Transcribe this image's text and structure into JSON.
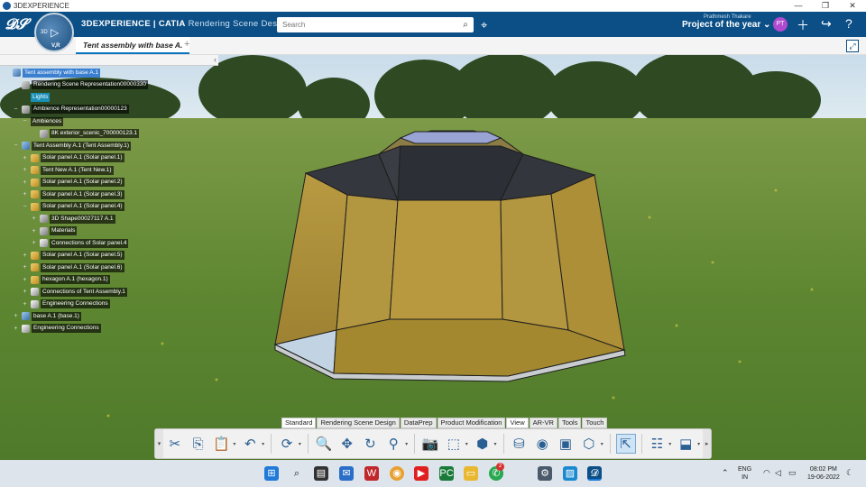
{
  "window": {
    "title": "3DEXPERIENCE",
    "controls": [
      "—",
      "❐",
      "✕"
    ]
  },
  "header": {
    "brand_main": "3DEXPERIENCE | CATIA",
    "brand_sub": "Rendering Scene Design",
    "search_placeholder": "Search",
    "user_name": "Prathmesh Thakare",
    "project": "Project of the year",
    "avatar": "PT"
  },
  "compass": {
    "label_3d": "3D",
    "label_v": "V,R"
  },
  "tabs": {
    "active": "Tent assembly with base A.",
    "add": "+"
  },
  "tree": [
    {
      "label": "Tent assembly with base A.1",
      "icon": "prod",
      "pm": "−",
      "level": 0,
      "style": "sel"
    },
    {
      "label": "Rendering Scene Representation00000330",
      "icon": "rep",
      "pm": "+",
      "level": 1,
      "style": ""
    },
    {
      "label": "Lights",
      "icon": "",
      "pm": "",
      "level": 2,
      "style": "hl"
    },
    {
      "label": "Ambience Representation00000123",
      "icon": "rep",
      "pm": "−",
      "level": 1,
      "style": ""
    },
    {
      "label": "Ambiences",
      "icon": "",
      "pm": "−",
      "level": 2,
      "style": ""
    },
    {
      "label": "8K exterior_scenic_700000123.1",
      "icon": "rep",
      "pm": "",
      "level": 3,
      "style": ""
    },
    {
      "label": "Tent Assembly A.1 (Tent Assembly.1)",
      "icon": "prod",
      "pm": "−",
      "level": 1,
      "style": ""
    },
    {
      "label": "Solar panel A.1 (Solar panel.1)",
      "icon": "part",
      "pm": "+",
      "level": 2,
      "style": ""
    },
    {
      "label": "Tent New A.1 (Tent New.1)",
      "icon": "part",
      "pm": "+",
      "level": 2,
      "style": ""
    },
    {
      "label": "Solar panel A.1 (Solar panel.2)",
      "icon": "part",
      "pm": "+",
      "level": 2,
      "style": ""
    },
    {
      "label": "Solar panel A.1 (Solar panel.3)",
      "icon": "part",
      "pm": "+",
      "level": 2,
      "style": ""
    },
    {
      "label": "Solar panel A.1 (Solar panel.4)",
      "icon": "part",
      "pm": "−",
      "level": 2,
      "style": ""
    },
    {
      "label": "3D Shape00027117 A.1",
      "icon": "rep",
      "pm": "+",
      "level": 3,
      "style": ""
    },
    {
      "label": "Materials",
      "icon": "rep",
      "pm": "+",
      "level": 3,
      "style": ""
    },
    {
      "label": "Connections of Solar panel.4",
      "icon": "conn",
      "pm": "+",
      "level": 3,
      "style": ""
    },
    {
      "label": "Solar panel A.1 (Solar panel.5)",
      "icon": "part",
      "pm": "+",
      "level": 2,
      "style": ""
    },
    {
      "label": "Solar panel A.1 (Solar panel.6)",
      "icon": "part",
      "pm": "+",
      "level": 2,
      "style": ""
    },
    {
      "label": "hexagon A.1 (hexagon.1)",
      "icon": "part",
      "pm": "+",
      "level": 2,
      "style": ""
    },
    {
      "label": "Connections of Tent Assembly.1",
      "icon": "conn",
      "pm": "+",
      "level": 2,
      "style": ""
    },
    {
      "label": "Engineering Connections",
      "icon": "conn",
      "pm": "+",
      "level": 2,
      "style": ""
    },
    {
      "label": "base A.1 (base.1)",
      "icon": "prod",
      "pm": "+",
      "level": 1,
      "style": ""
    },
    {
      "label": "Engineering Connections",
      "icon": "conn",
      "pm": "+",
      "level": 1,
      "style": ""
    }
  ],
  "action_tabs": [
    "Standard",
    "Rendering Scene Design",
    "DataPrep",
    "Product Modification",
    "View",
    "AR-VR",
    "Tools",
    "Touch"
  ],
  "active_action_tab": "View",
  "taskbar": {
    "lang": "ENG",
    "region": "IN",
    "time": "08:02 PM",
    "date": "19-06-2022",
    "badge": "2"
  },
  "colors": {
    "accent": "#0b4f86",
    "tent_wall": "#b5983f",
    "tent_roof": "#2f3238"
  }
}
